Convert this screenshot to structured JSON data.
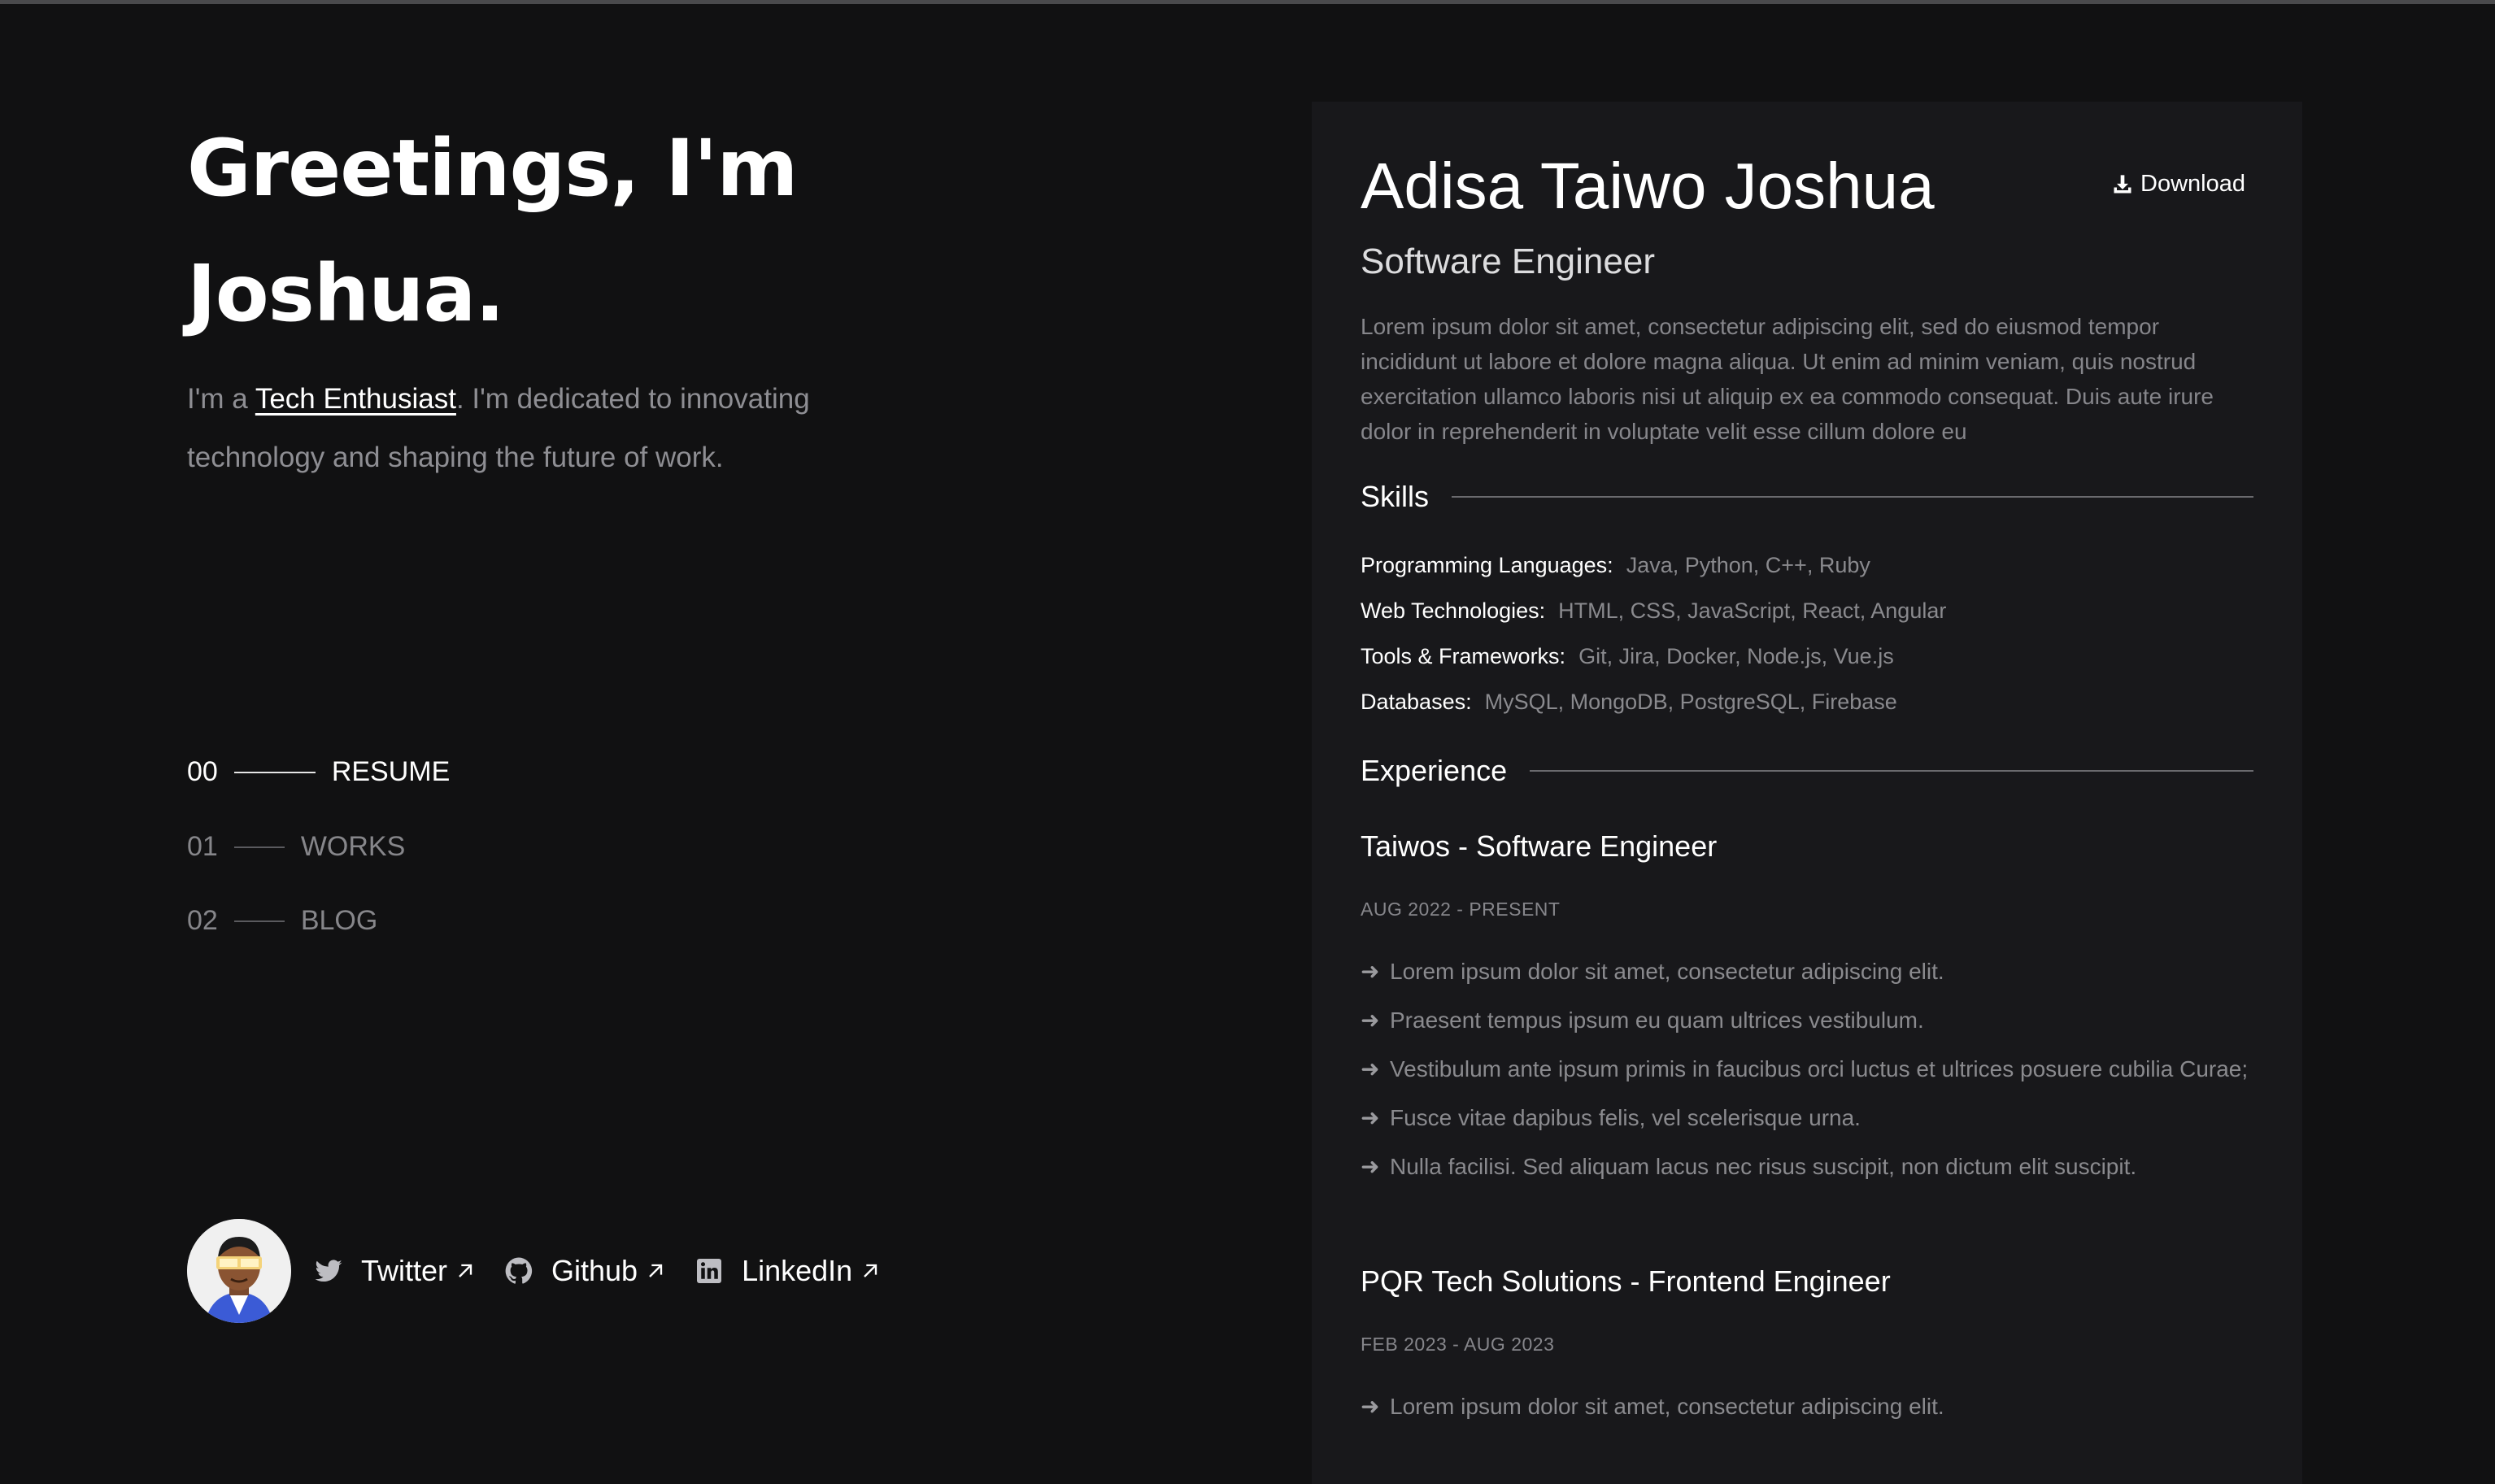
{
  "hero": {
    "line1": "Greetings, I'm",
    "line2": "Joshua.",
    "intro_prefix": "I'm a ",
    "intro_link": "Tech Enthusiast",
    "intro_suffix": ". I'm dedicated to innovating technology and shaping the future of work."
  },
  "nav": [
    {
      "num": "00",
      "label": "RESUME",
      "active": true
    },
    {
      "num": "01",
      "label": "WORKS",
      "active": false
    },
    {
      "num": "02",
      "label": "BLOG",
      "active": false
    }
  ],
  "social": [
    {
      "label": "Twitter",
      "icon": "twitter-icon"
    },
    {
      "label": "Github",
      "icon": "github-icon"
    },
    {
      "label": "LinkedIn",
      "icon": "linkedin-icon"
    }
  ],
  "resume": {
    "name": "Adisa Taiwo Joshua",
    "download_label": "Download",
    "role": "Software Engineer",
    "summary": "Lorem ipsum dolor sit amet, consectetur adipiscing elit, sed do eiusmod tempor incididunt ut labore et dolore magna aliqua. Ut enim ad minim veniam, quis nostrud exercitation ullamco laboris nisi ut aliquip ex ea commodo consequat. Duis aute irure dolor in reprehenderit in voluptate velit esse cillum dolore eu",
    "skills_heading": "Skills",
    "skills": [
      {
        "key": "Programming Languages:",
        "value": "Java, Python, C++, Ruby"
      },
      {
        "key": "Web Technologies:",
        "value": "HTML, CSS, JavaScript, React, Angular"
      },
      {
        "key": "Tools & Frameworks:",
        "value": "Git, Jira, Docker, Node.js, Vue.js"
      },
      {
        "key": "Databases:",
        "value": "MySQL, MongoDB, PostgreSQL, Firebase"
      }
    ],
    "experience_heading": "Experience",
    "jobs": [
      {
        "title": "Taiwos - Software Engineer",
        "dates": "AUG 2022 - PRESENT",
        "bullets": [
          "Lorem ipsum dolor sit amet, consectetur adipiscing elit.",
          "Praesent tempus ipsum eu quam ultrices vestibulum.",
          "Vestibulum ante ipsum primis in faucibus orci luctus et ultrices posuere cubilia Curae;",
          "Fusce vitae dapibus felis, vel scelerisque urna.",
          "Nulla facilisi. Sed aliquam lacus nec risus suscipit, non dictum elit suscipit."
        ]
      },
      {
        "title": "PQR Tech Solutions - Frontend Engineer",
        "dates": "FEB 2023 - AUG 2023",
        "bullets": [
          "Lorem ipsum dolor sit amet, consectetur adipiscing elit."
        ]
      }
    ]
  }
}
